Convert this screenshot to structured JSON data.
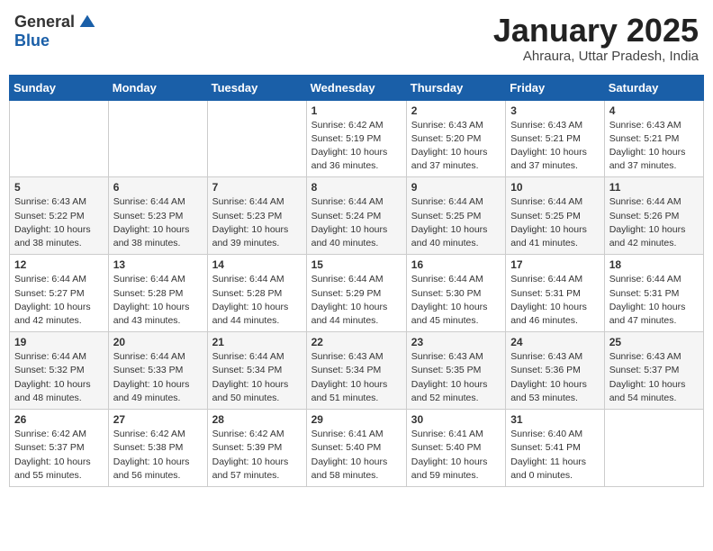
{
  "logo": {
    "general": "General",
    "blue": "Blue"
  },
  "title": "January 2025",
  "location": "Ahraura, Uttar Pradesh, India",
  "weekdays": [
    "Sunday",
    "Monday",
    "Tuesday",
    "Wednesday",
    "Thursday",
    "Friday",
    "Saturday"
  ],
  "weeks": [
    [
      {
        "day": "",
        "info": ""
      },
      {
        "day": "",
        "info": ""
      },
      {
        "day": "",
        "info": ""
      },
      {
        "day": "1",
        "info": "Sunrise: 6:42 AM\nSunset: 5:19 PM\nDaylight: 10 hours and 36 minutes."
      },
      {
        "day": "2",
        "info": "Sunrise: 6:43 AM\nSunset: 5:20 PM\nDaylight: 10 hours and 37 minutes."
      },
      {
        "day": "3",
        "info": "Sunrise: 6:43 AM\nSunset: 5:21 PM\nDaylight: 10 hours and 37 minutes."
      },
      {
        "day": "4",
        "info": "Sunrise: 6:43 AM\nSunset: 5:21 PM\nDaylight: 10 hours and 37 minutes."
      }
    ],
    [
      {
        "day": "5",
        "info": "Sunrise: 6:43 AM\nSunset: 5:22 PM\nDaylight: 10 hours and 38 minutes."
      },
      {
        "day": "6",
        "info": "Sunrise: 6:44 AM\nSunset: 5:23 PM\nDaylight: 10 hours and 38 minutes."
      },
      {
        "day": "7",
        "info": "Sunrise: 6:44 AM\nSunset: 5:23 PM\nDaylight: 10 hours and 39 minutes."
      },
      {
        "day": "8",
        "info": "Sunrise: 6:44 AM\nSunset: 5:24 PM\nDaylight: 10 hours and 40 minutes."
      },
      {
        "day": "9",
        "info": "Sunrise: 6:44 AM\nSunset: 5:25 PM\nDaylight: 10 hours and 40 minutes."
      },
      {
        "day": "10",
        "info": "Sunrise: 6:44 AM\nSunset: 5:25 PM\nDaylight: 10 hours and 41 minutes."
      },
      {
        "day": "11",
        "info": "Sunrise: 6:44 AM\nSunset: 5:26 PM\nDaylight: 10 hours and 42 minutes."
      }
    ],
    [
      {
        "day": "12",
        "info": "Sunrise: 6:44 AM\nSunset: 5:27 PM\nDaylight: 10 hours and 42 minutes."
      },
      {
        "day": "13",
        "info": "Sunrise: 6:44 AM\nSunset: 5:28 PM\nDaylight: 10 hours and 43 minutes."
      },
      {
        "day": "14",
        "info": "Sunrise: 6:44 AM\nSunset: 5:28 PM\nDaylight: 10 hours and 44 minutes."
      },
      {
        "day": "15",
        "info": "Sunrise: 6:44 AM\nSunset: 5:29 PM\nDaylight: 10 hours and 44 minutes."
      },
      {
        "day": "16",
        "info": "Sunrise: 6:44 AM\nSunset: 5:30 PM\nDaylight: 10 hours and 45 minutes."
      },
      {
        "day": "17",
        "info": "Sunrise: 6:44 AM\nSunset: 5:31 PM\nDaylight: 10 hours and 46 minutes."
      },
      {
        "day": "18",
        "info": "Sunrise: 6:44 AM\nSunset: 5:31 PM\nDaylight: 10 hours and 47 minutes."
      }
    ],
    [
      {
        "day": "19",
        "info": "Sunrise: 6:44 AM\nSunset: 5:32 PM\nDaylight: 10 hours and 48 minutes."
      },
      {
        "day": "20",
        "info": "Sunrise: 6:44 AM\nSunset: 5:33 PM\nDaylight: 10 hours and 49 minutes."
      },
      {
        "day": "21",
        "info": "Sunrise: 6:44 AM\nSunset: 5:34 PM\nDaylight: 10 hours and 50 minutes."
      },
      {
        "day": "22",
        "info": "Sunrise: 6:43 AM\nSunset: 5:34 PM\nDaylight: 10 hours and 51 minutes."
      },
      {
        "day": "23",
        "info": "Sunrise: 6:43 AM\nSunset: 5:35 PM\nDaylight: 10 hours and 52 minutes."
      },
      {
        "day": "24",
        "info": "Sunrise: 6:43 AM\nSunset: 5:36 PM\nDaylight: 10 hours and 53 minutes."
      },
      {
        "day": "25",
        "info": "Sunrise: 6:43 AM\nSunset: 5:37 PM\nDaylight: 10 hours and 54 minutes."
      }
    ],
    [
      {
        "day": "26",
        "info": "Sunrise: 6:42 AM\nSunset: 5:37 PM\nDaylight: 10 hours and 55 minutes."
      },
      {
        "day": "27",
        "info": "Sunrise: 6:42 AM\nSunset: 5:38 PM\nDaylight: 10 hours and 56 minutes."
      },
      {
        "day": "28",
        "info": "Sunrise: 6:42 AM\nSunset: 5:39 PM\nDaylight: 10 hours and 57 minutes."
      },
      {
        "day": "29",
        "info": "Sunrise: 6:41 AM\nSunset: 5:40 PM\nDaylight: 10 hours and 58 minutes."
      },
      {
        "day": "30",
        "info": "Sunrise: 6:41 AM\nSunset: 5:40 PM\nDaylight: 10 hours and 59 minutes."
      },
      {
        "day": "31",
        "info": "Sunrise: 6:40 AM\nSunset: 5:41 PM\nDaylight: 11 hours and 0 minutes."
      },
      {
        "day": "",
        "info": ""
      }
    ]
  ]
}
